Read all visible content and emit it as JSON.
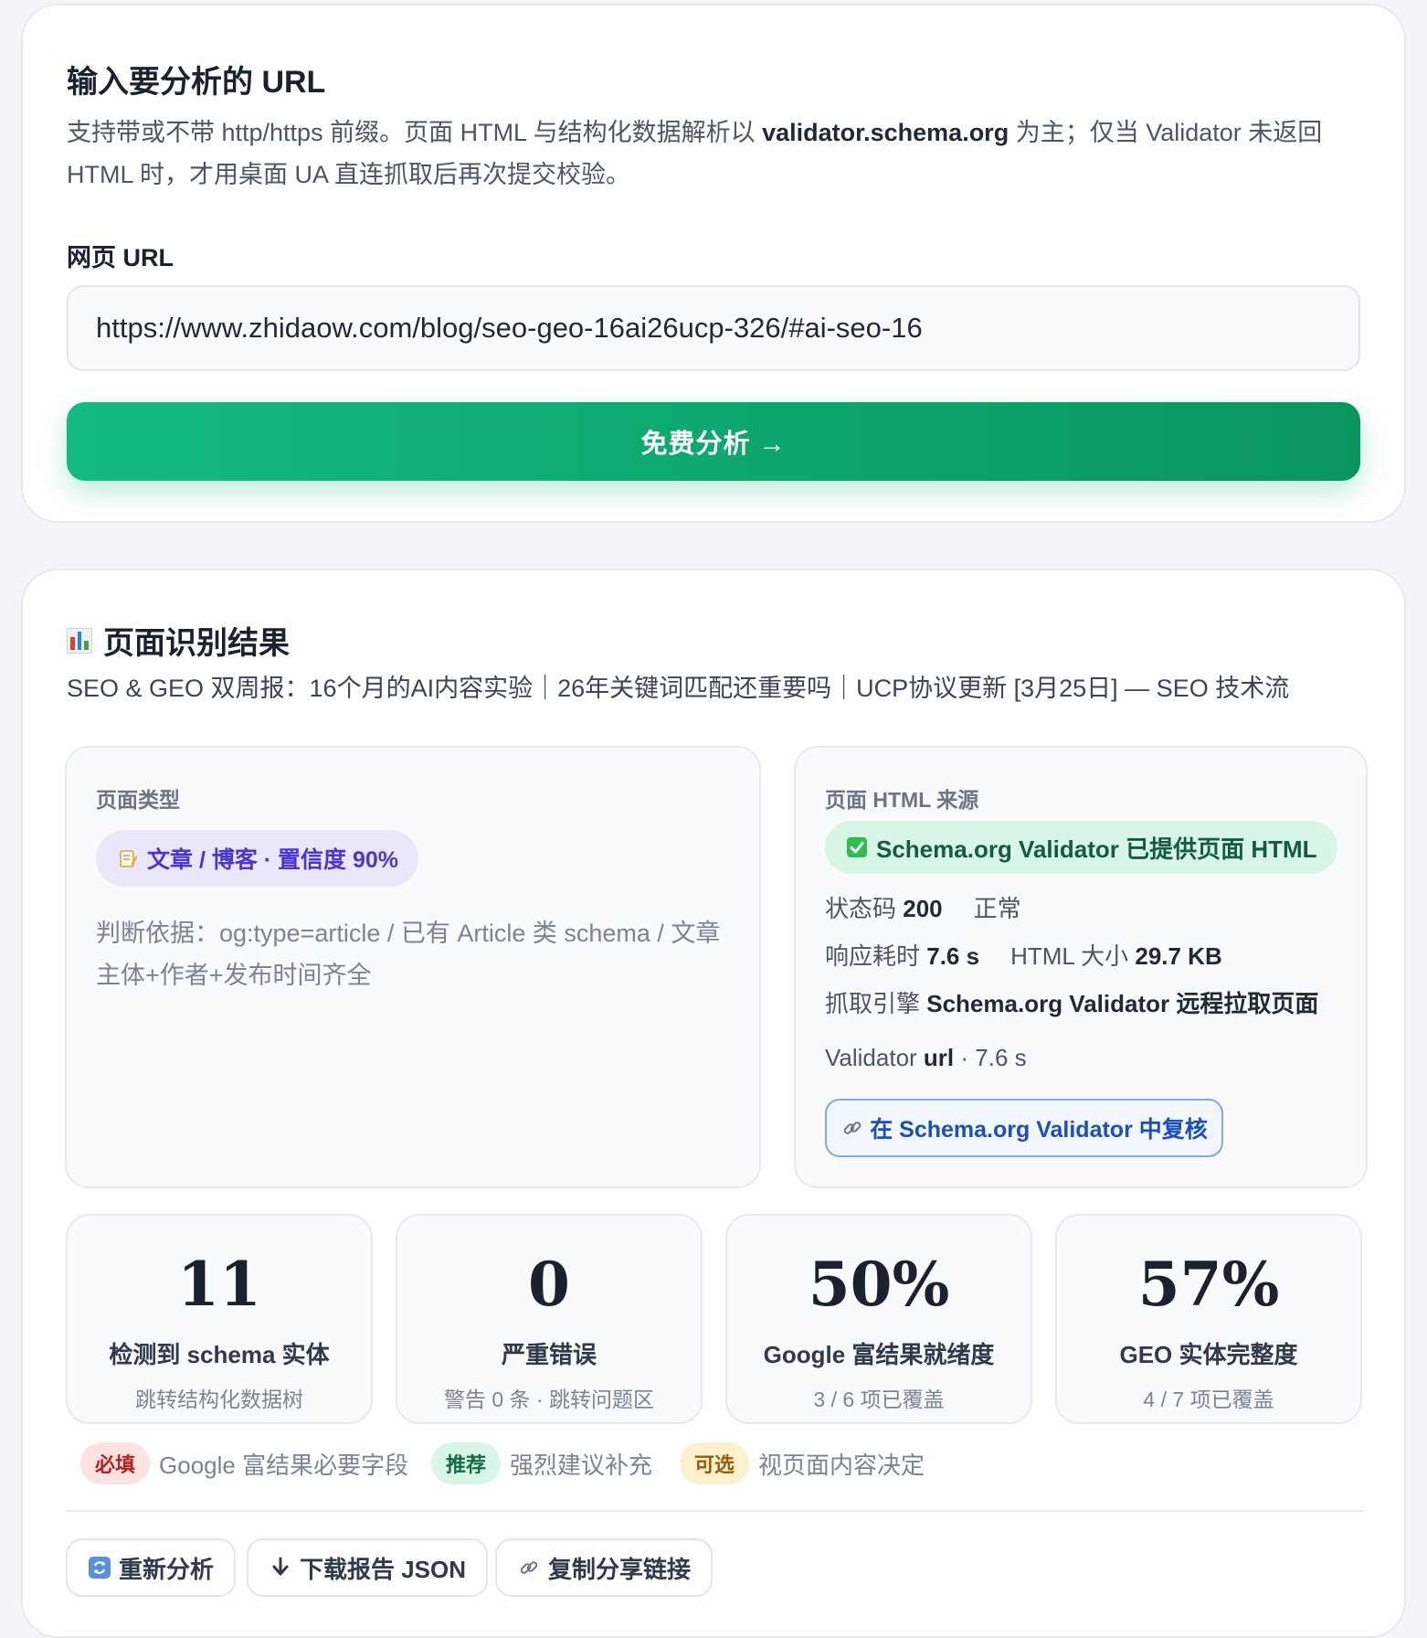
{
  "input_card": {
    "title": "输入要分析的 URL",
    "description_prefix": "支持带或不带 http/https 前缀。页面 HTML 与结构化数据解析以 ",
    "description_bold": "validator.schema.org",
    "description_suffix": " 为主；仅当 Validator 未返回 HTML 时，才用桌面 UA 直连抓取后再次提交校验。",
    "url_label": "网页 URL",
    "url_value": "https://www.zhidaow.com/blog/seo-geo-16ai26ucp-326/#ai-seo-16",
    "analyze_button": "免费分析 →"
  },
  "result_card": {
    "title": "页面识别结果",
    "title_icon": "bar-chart-icon",
    "page_title": "SEO & GEO 双周报：16个月的AI内容实验｜26年关键词匹配还重要吗｜UCP协议更新 [3月25日] — SEO 技术流",
    "page_type": {
      "label": "页面类型",
      "pill_icon": "memo-icon",
      "pill_text": "文章 / 博客 · 置信度 90%",
      "basis": "判断依据：og:type=article / 已有 Article 类 schema / 文章主体+作者+发布时间齐全"
    },
    "html_source": {
      "label": "页面 HTML 来源",
      "status_icon": "check-icon",
      "status_text": "Schema.org Validator 已提供页面 HTML",
      "status_code_label": "状态码",
      "status_code": "200",
      "status_text_normal": "正常",
      "response_time_label": "响应耗时",
      "response_time": "7.6 s",
      "html_size_label": "HTML 大小",
      "html_size": "29.7 KB",
      "engine_label": "抓取引擎",
      "engine": "Schema.org Validator 远程拉取页面",
      "validator_label": "Validator",
      "validator_mode": "url",
      "validator_time": "· 7.6 s",
      "recheck_button": "在 Schema.org Validator 中复核"
    },
    "stats": [
      {
        "value": "11",
        "title": "检测到 schema 实体",
        "sub": "跳转结构化数据树"
      },
      {
        "value": "0",
        "title": "严重错误",
        "sub": "警告 0 条 · 跳转问题区"
      },
      {
        "value": "50%",
        "title": "Google 富结果就绪度",
        "sub": "3 / 6 项已覆盖"
      },
      {
        "value": "57%",
        "title": "GEO 实体完整度",
        "sub": "4 / 7 项已覆盖"
      }
    ],
    "legend": [
      {
        "tag": "必填",
        "text": "Google 富结果必要字段",
        "color": "#b42323"
      },
      {
        "tag": "推荐",
        "text": "强烈建议补充",
        "color": "#146b44"
      },
      {
        "tag": "可选",
        "text": "视页面内容决定",
        "color": "#955d08"
      }
    ],
    "actions": {
      "reanalyze": "重新分析",
      "download": "下载报告 JSON",
      "copy_link": "复制分享链接"
    }
  }
}
